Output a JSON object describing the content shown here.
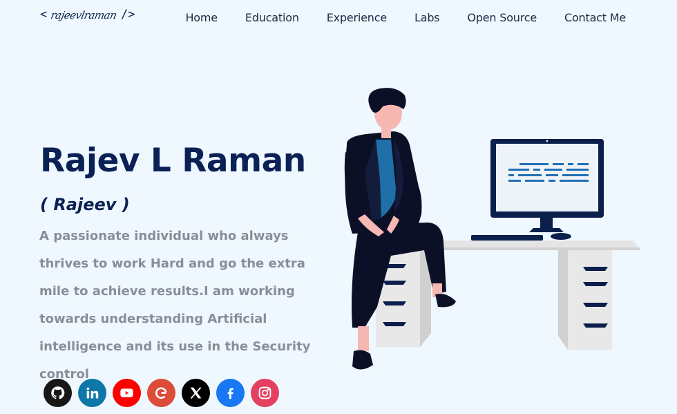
{
  "logo": {
    "open": "<",
    "signature": "rajeevlraman",
    "close": "/>"
  },
  "nav": [
    "Home",
    "Education",
    "Experience",
    "Labs",
    "Open Source",
    "Contact Me"
  ],
  "hero": {
    "name": "Rajev L Raman",
    "nickname": "( Rajeev )",
    "description": "A passionate individual who always thrives to work Hard and go the extra mile to achieve results.I am working towards understanding Artificial intelligence and its use in the Security control"
  },
  "socials": [
    {
      "icon": "github-icon",
      "color": "#181717"
    },
    {
      "icon": "linkedin-icon",
      "color": "#0e76a8"
    },
    {
      "icon": "youtube-icon",
      "color": "#ff0000"
    },
    {
      "icon": "google-icon",
      "color": "#dd4b39"
    },
    {
      "icon": "x-icon",
      "color": "#000000"
    },
    {
      "icon": "facebook-icon",
      "color": "#1877f2"
    },
    {
      "icon": "instagram-icon",
      "color": "#e4405f"
    }
  ],
  "colors": {
    "background": "#eef8fe",
    "heading": "#0b2054",
    "text": "#8a8d98"
  }
}
